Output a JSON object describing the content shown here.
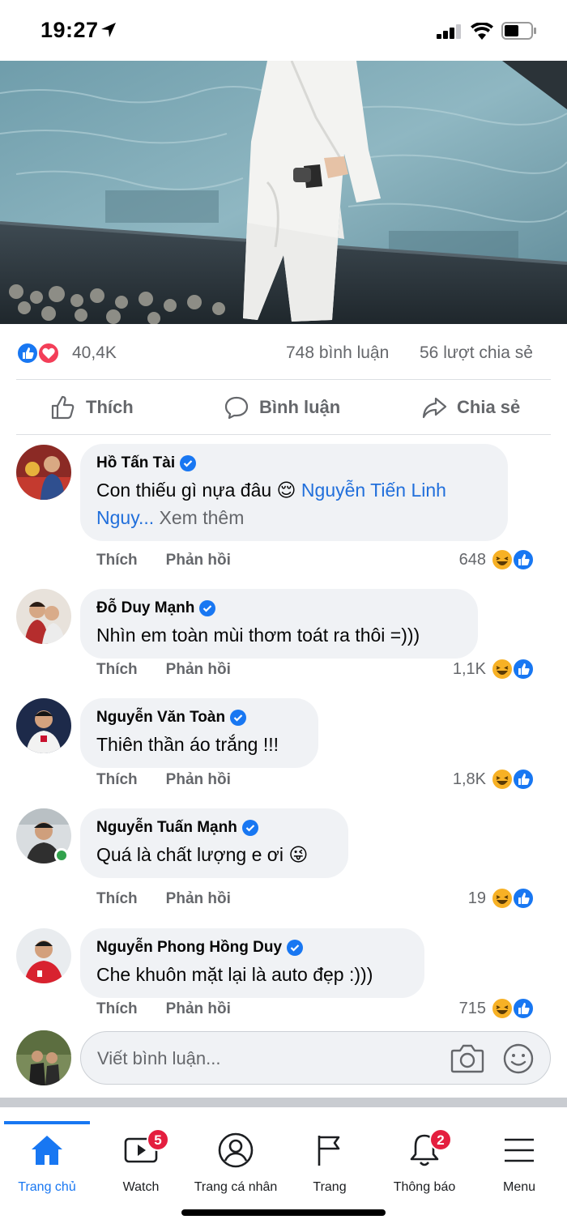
{
  "status_bar": {
    "time": "19:27"
  },
  "post": {
    "reaction_count": "40,4K",
    "comment_count": "748 bình luận",
    "share_count": "56 lượt chia sẻ",
    "actions": {
      "like": "Thích",
      "comment": "Bình luận",
      "share": "Chia sẻ"
    }
  },
  "comments": [
    {
      "name": "Hồ Tấn Tài",
      "text": "Con thiếu gì nựa đâu 😌",
      "tag": "Nguyễn Tiến Linh",
      "tag_cont": "Nguy...",
      "more": "Xem thêm",
      "like": "Thích",
      "reply": "Phản hồi",
      "reactions": "648"
    },
    {
      "name": "Đỗ Duy Mạnh",
      "text": "Nhìn em toàn mùi thơm toát ra thôi =)))",
      "like": "Thích",
      "reply": "Phản hồi",
      "reactions": "1,1K"
    },
    {
      "name": "Nguyễn Văn Toàn",
      "text": "Thiên thần áo trắng !!!",
      "like": "Thích",
      "reply": "Phản hồi",
      "reactions": "1,8K"
    },
    {
      "name": "Nguyễn Tuấn Mạnh",
      "text": "Quá là chất lượng e ơi 😜",
      "like": "Thích",
      "reply": "Phản hồi",
      "reactions": "19"
    },
    {
      "name": "Nguyễn Phong Hồng Duy",
      "text": "Che khuôn mặt lại là auto đẹp :)))",
      "like": "Thích",
      "reply": "Phản hồi",
      "reactions": "715"
    }
  ],
  "write_comment": {
    "placeholder": "Viết bình luận..."
  },
  "tabs": [
    {
      "label": "Trang chủ",
      "icon": "home-icon",
      "active": true
    },
    {
      "label": "Watch",
      "icon": "watch-icon",
      "badge": "5"
    },
    {
      "label": "Trang cá nhân",
      "icon": "profile-icon"
    },
    {
      "label": "Trang",
      "icon": "flag-icon"
    },
    {
      "label": "Thông báo",
      "icon": "bell-icon",
      "badge": "2"
    },
    {
      "label": "Menu",
      "icon": "menu-icon"
    }
  ],
  "colors": {
    "accent": "#1877f2",
    "muted": "#65676b",
    "bubble": "#f0f2f5",
    "badge": "#e41e3f"
  }
}
